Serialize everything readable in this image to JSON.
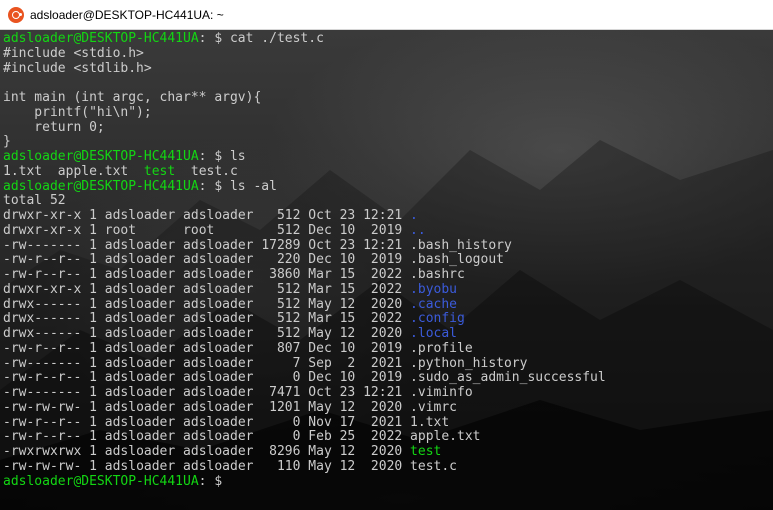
{
  "window": {
    "title": "adsloader@DESKTOP-HC441UA: ~",
    "icon": "ubuntu-icon"
  },
  "colors": {
    "prompt": "#13d613",
    "directory": "#3b5bdb",
    "executable": "#13d613",
    "text": "#cccccc"
  },
  "prompt": "adsloader@DESKTOP-HC441UA",
  "prompt_suffix": ": $ ",
  "lines": [
    {
      "type": "prompt",
      "cmd": "cat ./test.c"
    },
    {
      "type": "text",
      "text": "#include <stdio.h>"
    },
    {
      "type": "text",
      "text": "#include <stdlib.h>"
    },
    {
      "type": "text",
      "text": ""
    },
    {
      "type": "text",
      "text": "int main (int argc, char** argv){"
    },
    {
      "type": "text",
      "text": "    printf(\"hi\\n\");"
    },
    {
      "type": "text",
      "text": "    return 0;"
    },
    {
      "type": "text",
      "text": "}"
    },
    {
      "type": "prompt",
      "cmd": "ls"
    },
    {
      "type": "ls",
      "items": [
        {
          "name": "1.txt",
          "kind": "file"
        },
        {
          "name": "apple.txt",
          "kind": "file"
        },
        {
          "name": "test",
          "kind": "exec"
        },
        {
          "name": "test.c",
          "kind": "file"
        }
      ]
    },
    {
      "type": "prompt",
      "cmd": "ls -al"
    },
    {
      "type": "text",
      "text": "total 52"
    },
    {
      "type": "entry",
      "perm": "drwxr-xr-x",
      "links": "1",
      "owner": "adsloader",
      "group": "adsloader",
      "size": "512",
      "date": "Oct 23 12:21",
      "name": ".",
      "kind": "dir"
    },
    {
      "type": "entry",
      "perm": "drwxr-xr-x",
      "links": "1",
      "owner": "root",
      "group": "root",
      "size": "512",
      "date": "Dec 10  2019",
      "name": "..",
      "kind": "dir"
    },
    {
      "type": "entry",
      "perm": "-rw-------",
      "links": "1",
      "owner": "adsloader",
      "group": "adsloader",
      "size": "17289",
      "date": "Oct 23 12:21",
      "name": ".bash_history",
      "kind": "file"
    },
    {
      "type": "entry",
      "perm": "-rw-r--r--",
      "links": "1",
      "owner": "adsloader",
      "group": "adsloader",
      "size": "220",
      "date": "Dec 10  2019",
      "name": ".bash_logout",
      "kind": "file"
    },
    {
      "type": "entry",
      "perm": "-rw-r--r--",
      "links": "1",
      "owner": "adsloader",
      "group": "adsloader",
      "size": "3860",
      "date": "Mar 15  2022",
      "name": ".bashrc",
      "kind": "file"
    },
    {
      "type": "entry",
      "perm": "drwxr-xr-x",
      "links": "1",
      "owner": "adsloader",
      "group": "adsloader",
      "size": "512",
      "date": "Mar 15  2022",
      "name": ".byobu",
      "kind": "dir"
    },
    {
      "type": "entry",
      "perm": "drwx------",
      "links": "1",
      "owner": "adsloader",
      "group": "adsloader",
      "size": "512",
      "date": "May 12  2020",
      "name": ".cache",
      "kind": "dir"
    },
    {
      "type": "entry",
      "perm": "drwx------",
      "links": "1",
      "owner": "adsloader",
      "group": "adsloader",
      "size": "512",
      "date": "Mar 15  2022",
      "name": ".config",
      "kind": "dir"
    },
    {
      "type": "entry",
      "perm": "drwx------",
      "links": "1",
      "owner": "adsloader",
      "group": "adsloader",
      "size": "512",
      "date": "May 12  2020",
      "name": ".local",
      "kind": "dir"
    },
    {
      "type": "entry",
      "perm": "-rw-r--r--",
      "links": "1",
      "owner": "adsloader",
      "group": "adsloader",
      "size": "807",
      "date": "Dec 10  2019",
      "name": ".profile",
      "kind": "file"
    },
    {
      "type": "entry",
      "perm": "-rw-------",
      "links": "1",
      "owner": "adsloader",
      "group": "adsloader",
      "size": "7",
      "date": "Sep  2  2021",
      "name": ".python_history",
      "kind": "file"
    },
    {
      "type": "entry",
      "perm": "-rw-r--r--",
      "links": "1",
      "owner": "adsloader",
      "group": "adsloader",
      "size": "0",
      "date": "Dec 10  2019",
      "name": ".sudo_as_admin_successful",
      "kind": "file"
    },
    {
      "type": "entry",
      "perm": "-rw-------",
      "links": "1",
      "owner": "adsloader",
      "group": "adsloader",
      "size": "7471",
      "date": "Oct 23 12:21",
      "name": ".viminfo",
      "kind": "file"
    },
    {
      "type": "entry",
      "perm": "-rw-rw-rw-",
      "links": "1",
      "owner": "adsloader",
      "group": "adsloader",
      "size": "1201",
      "date": "May 12  2020",
      "name": ".vimrc",
      "kind": "file"
    },
    {
      "type": "entry",
      "perm": "-rw-r--r--",
      "links": "1",
      "owner": "adsloader",
      "group": "adsloader",
      "size": "0",
      "date": "Nov 17  2021",
      "name": "1.txt",
      "kind": "file"
    },
    {
      "type": "entry",
      "perm": "-rw-r--r--",
      "links": "1",
      "owner": "adsloader",
      "group": "adsloader",
      "size": "0",
      "date": "Feb 25  2022",
      "name": "apple.txt",
      "kind": "file"
    },
    {
      "type": "entry",
      "perm": "-rwxrwxrwx",
      "links": "1",
      "owner": "adsloader",
      "group": "adsloader",
      "size": "8296",
      "date": "May 12  2020",
      "name": "test",
      "kind": "exec"
    },
    {
      "type": "entry",
      "perm": "-rw-rw-rw-",
      "links": "1",
      "owner": "adsloader",
      "group": "adsloader",
      "size": "110",
      "date": "May 12  2020",
      "name": "test.c",
      "kind": "file"
    },
    {
      "type": "prompt",
      "cmd": ""
    }
  ]
}
